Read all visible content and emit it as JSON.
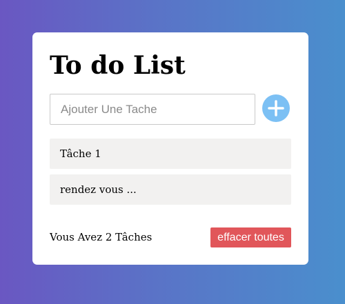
{
  "app": {
    "title": "To do List"
  },
  "input": {
    "placeholder": "Ajouter Une Tache",
    "value": ""
  },
  "add_button": {
    "icon": "plus-icon",
    "color": "#7cc0f4"
  },
  "tasks": [
    {
      "label": "Tâche 1"
    },
    {
      "label": "rendez vous ..."
    }
  ],
  "footer": {
    "count_text": "Vous Avez 2 Tâches",
    "clear_label": "effacer toutes",
    "clear_color": "#e1565a"
  }
}
